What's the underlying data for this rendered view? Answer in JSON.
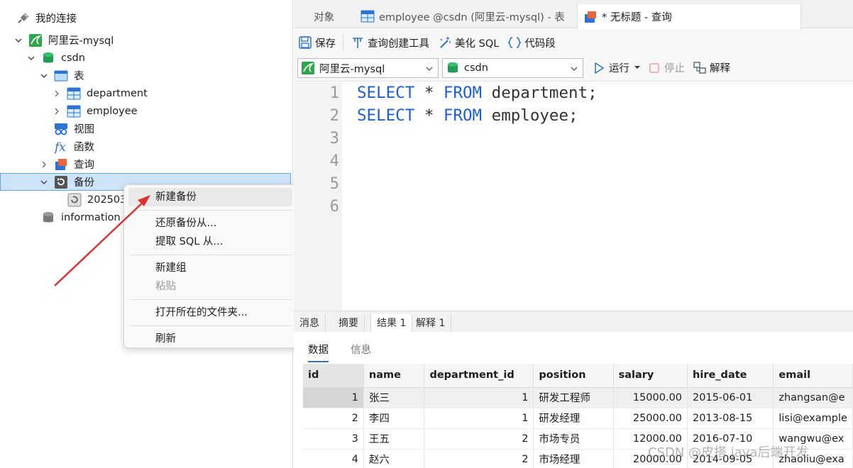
{
  "nav": {
    "root": "我的连接",
    "connection": "阿里云-mysql",
    "db_csdn": "csdn",
    "tables": "表",
    "table_department": "department",
    "table_employee": "employee",
    "views": "视图",
    "functions": "函数",
    "queries": "查询",
    "backups": "备份",
    "backup_item": "202503",
    "db_info": "information"
  },
  "context_menu": {
    "items": [
      "新建备份",
      "还原备份从...",
      "提取 SQL 从...",
      "新建组",
      "粘贴",
      "打开所在的文件夹...",
      "刷新"
    ]
  },
  "tabs": {
    "objects": "对象",
    "employee_tab": "employee @csdn (阿里云-mysql) - 表",
    "query_tab": "* 无标题 - 查询"
  },
  "toolbar": {
    "save": "保存",
    "query_builder": "查询创建工具",
    "beautify": "美化 SQL",
    "snippet": "代码段"
  },
  "selectors": {
    "connection": "阿里云-mysql",
    "database": "csdn",
    "run": "运行",
    "stop": "停止",
    "explain": "解释"
  },
  "editor": {
    "line_numbers": [
      "1",
      "2",
      "3",
      "4",
      "5",
      "6"
    ],
    "line1": {
      "kw1": "SELECT",
      "mid": " * ",
      "kw2": "FROM",
      "rest": " department;"
    },
    "line2": {
      "kw1": "SELECT",
      "mid": " * ",
      "kw2": "FROM",
      "rest": " employee;"
    }
  },
  "result_tabs": [
    "消息",
    "摘要",
    "结果 1",
    "解释 1"
  ],
  "sub_tabs": [
    "数据",
    "信息"
  ],
  "grid": {
    "columns": [
      "id",
      "name",
      "department_id",
      "position",
      "salary",
      "hire_date",
      "email"
    ],
    "rows": [
      [
        "1",
        "张三",
        "1",
        "研发工程师",
        "15000.00",
        "2015-06-01",
        "zhangsan@e"
      ],
      [
        "2",
        "李四",
        "1",
        "研发经理",
        "25000.00",
        "2013-08-15",
        "lisi@example"
      ],
      [
        "3",
        "王五",
        "2",
        "市场专员",
        "12000.00",
        "2016-07-10",
        "wangwu@ex"
      ],
      [
        "4",
        "赵六",
        "2",
        "市场经理",
        "20000.00",
        "2014-09-05",
        "zhaoliu@exa"
      ]
    ]
  },
  "watermark": "CSDN @皮搭 java后端开发",
  "colors": {
    "keyword": "#1a5fd6",
    "selection_bg": "#cde3f7",
    "annotation_arrow": "#e03030",
    "db_icon": "#1f9d55",
    "table_icon": "#2b74d6"
  }
}
